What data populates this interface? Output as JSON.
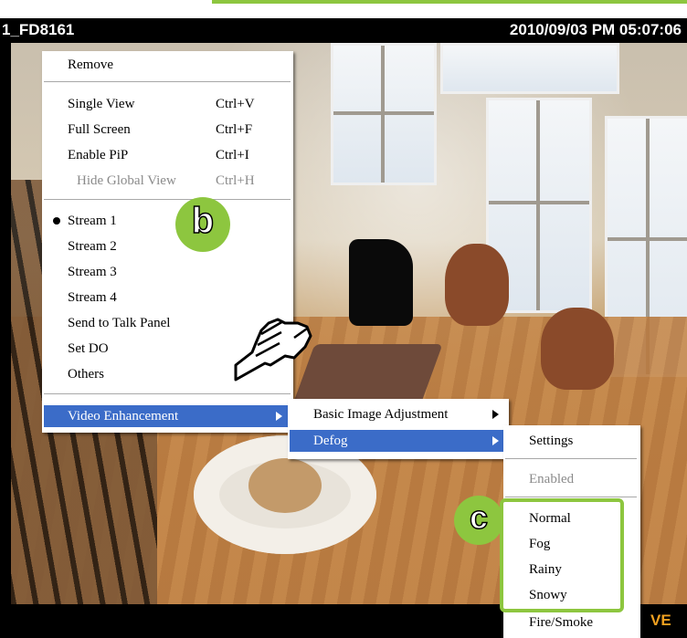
{
  "camera": {
    "name": "1_FD8161",
    "timestamp": "2010/09/03 PM 05:07:06",
    "status_tag": "VE"
  },
  "context_menu": {
    "remove": "Remove",
    "single_view": {
      "label": "Single View",
      "shortcut": "Ctrl+V"
    },
    "full_screen": {
      "label": "Full Screen",
      "shortcut": "Ctrl+F"
    },
    "enable_pip": {
      "label": "Enable PiP",
      "shortcut": "Ctrl+I"
    },
    "hide_global_view": {
      "label": "Hide Global View",
      "shortcut": "Ctrl+H"
    },
    "streams": [
      "Stream 1",
      "Stream 2",
      "Stream 3",
      "Stream 4"
    ],
    "selected_stream": "Stream 1",
    "send_to_talk_panel": "Send to Talk Panel",
    "set_do": "Set DO",
    "others": "Others",
    "video_enhancement": "Video Enhancement"
  },
  "video_enhancement_menu": {
    "basic_image_adjustment": "Basic Image Adjustment",
    "defog": "Defog"
  },
  "defog_menu": {
    "settings": "Settings",
    "enabled": "Enabled",
    "modes": [
      "Normal",
      "Fog",
      "Rainy",
      "Snowy",
      "Fire/Smoke"
    ]
  },
  "callouts": {
    "b": "b",
    "c": "c"
  },
  "colors": {
    "accent_green": "#8dc63f",
    "menu_highlight": "#3b6cc8",
    "ve_label": "#f0a020"
  }
}
